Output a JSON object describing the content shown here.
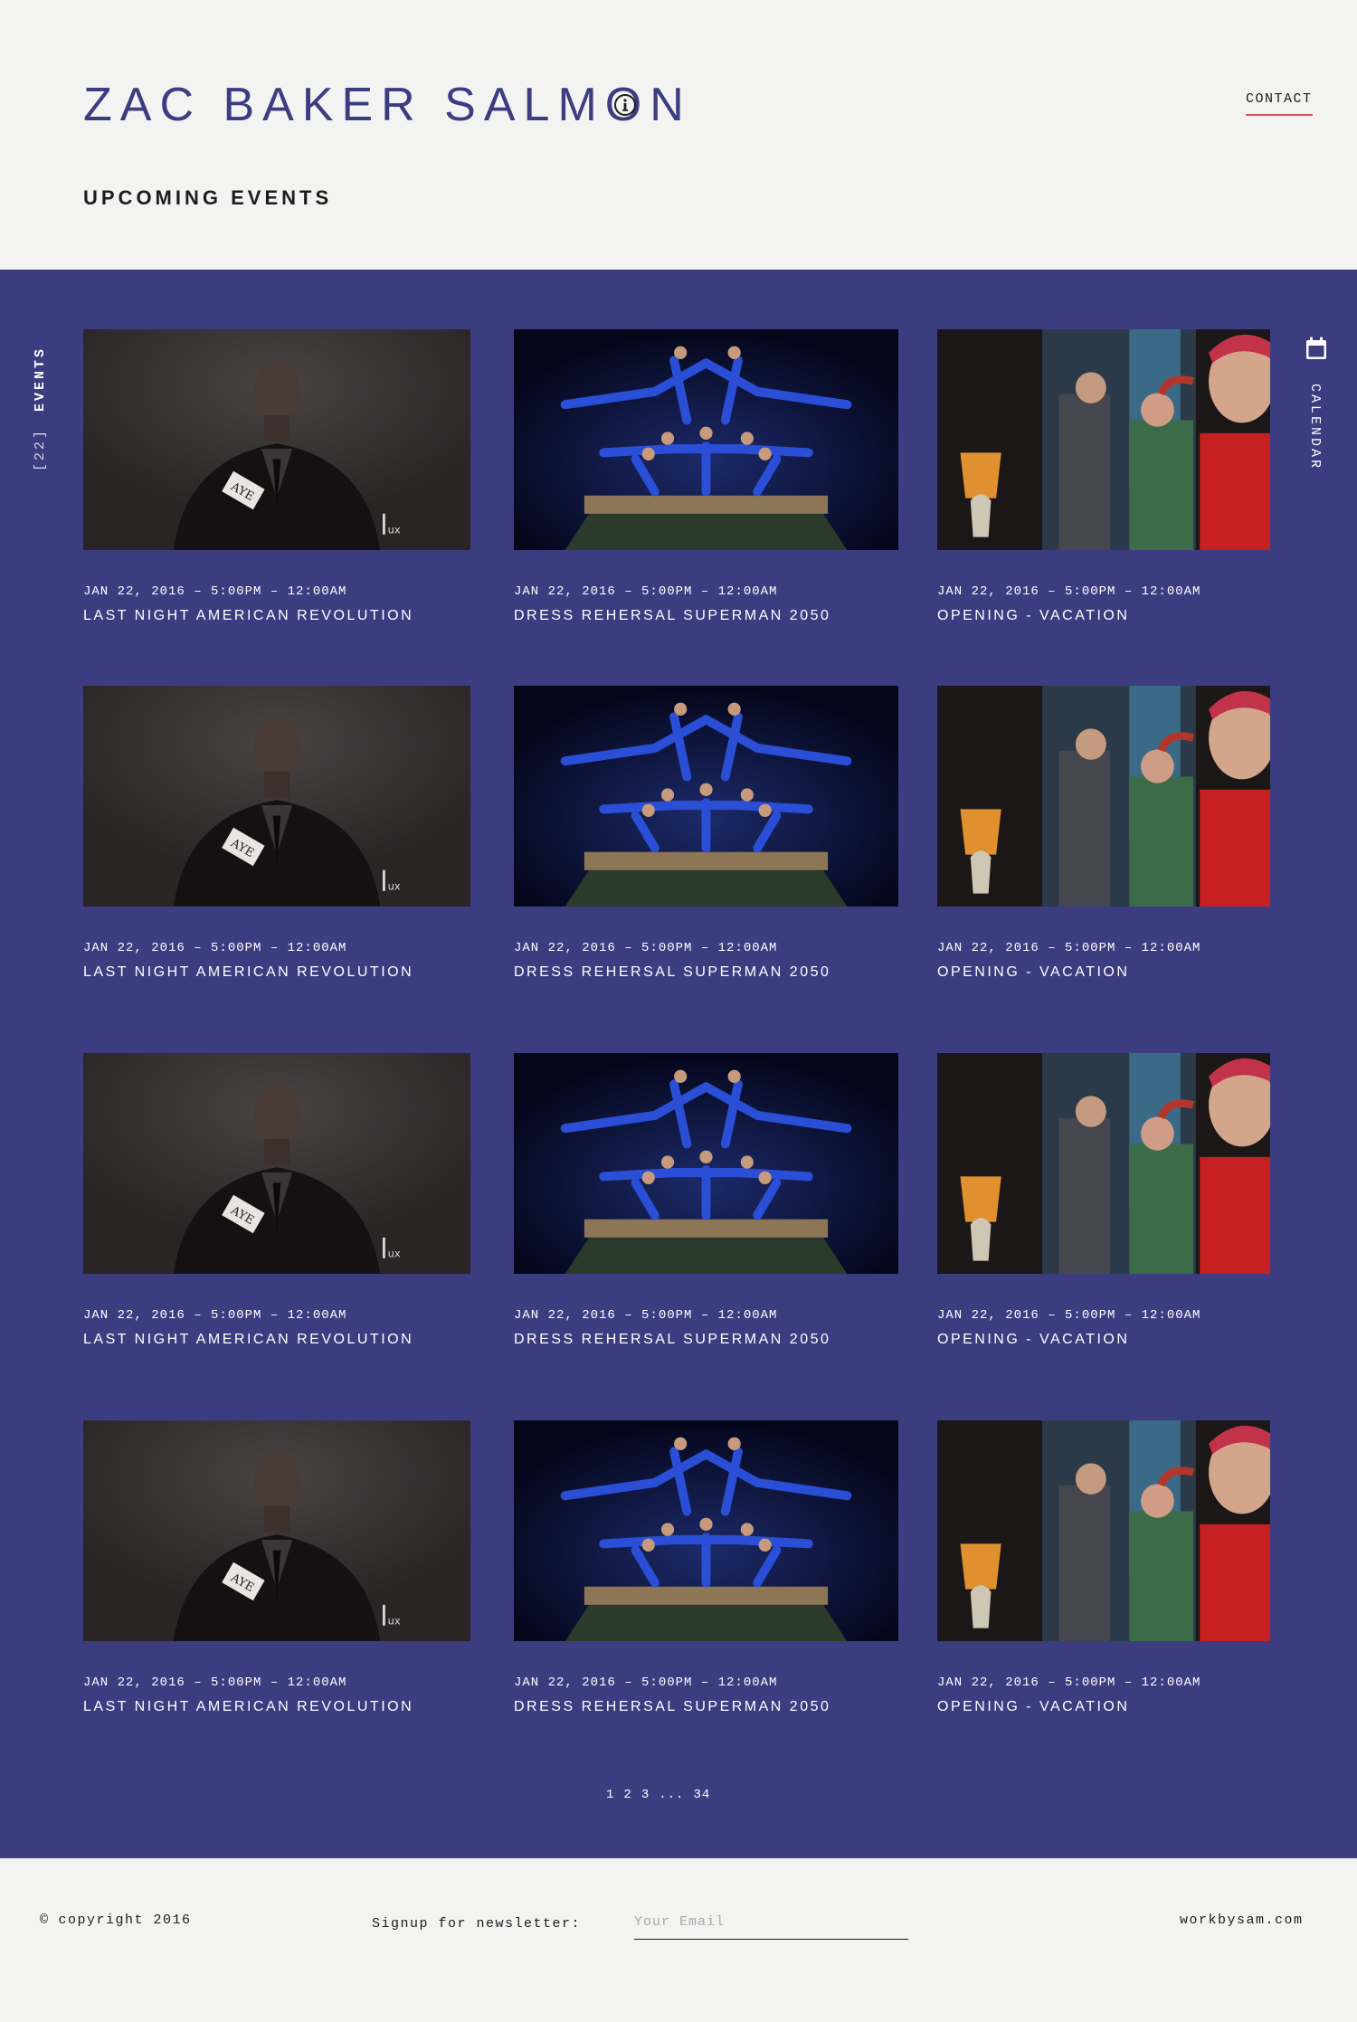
{
  "header": {
    "site_title": "ZAC BAKER SALMON",
    "contact_label": "CONTACT",
    "section_title": "UPCOMING EVENTS"
  },
  "sidebar_left": {
    "count": "[22]",
    "label": "EVENTS"
  },
  "sidebar_right": {
    "label": "CALENDAR",
    "icon": "calendar-icon"
  },
  "colors": {
    "band": "#3b3d80",
    "title": "#3b3d80",
    "accent_underline": "#d9534f",
    "page_bg": "#f3f3f2"
  },
  "events": [
    {
      "date": "JAN 22, 2016 – 5:00PM – 12:00AM",
      "title": "LAST NIGHT AMERICAN REVOLUTION",
      "image": "portrait"
    },
    {
      "date": "JAN 22, 2016 – 5:00PM – 12:00AM",
      "title": "DRESS REHERSAL SUPERMAN 2050",
      "image": "dancers"
    },
    {
      "date": "JAN 22, 2016 – 5:00PM – 12:00AM",
      "title": "OPENING - VACATION",
      "image": "scene"
    },
    {
      "date": "JAN 22, 2016 – 5:00PM – 12:00AM",
      "title": "LAST NIGHT AMERICAN REVOLUTION",
      "image": "portrait"
    },
    {
      "date": "JAN 22, 2016 – 5:00PM – 12:00AM",
      "title": "DRESS REHERSAL SUPERMAN 2050",
      "image": "dancers"
    },
    {
      "date": "JAN 22, 2016 – 5:00PM – 12:00AM",
      "title": "OPENING - VACATION",
      "image": "scene"
    },
    {
      "date": "JAN 22, 2016 – 5:00PM – 12:00AM",
      "title": "LAST NIGHT AMERICAN REVOLUTION",
      "image": "portrait"
    },
    {
      "date": "JAN 22, 2016 – 5:00PM – 12:00AM",
      "title": "DRESS REHERSAL SUPERMAN 2050",
      "image": "dancers"
    },
    {
      "date": "JAN 22, 2016 – 5:00PM – 12:00AM",
      "title": "OPENING - VACATION",
      "image": "scene"
    },
    {
      "date": "JAN 22, 2016 – 5:00PM – 12:00AM",
      "title": "LAST NIGHT AMERICAN REVOLUTION",
      "image": "portrait"
    },
    {
      "date": "JAN 22, 2016 – 5:00PM – 12:00AM",
      "title": "DRESS REHERSAL SUPERMAN 2050",
      "image": "dancers"
    },
    {
      "date": "JAN 22, 2016 – 5:00PM – 12:00AM",
      "title": "OPENING - VACATION",
      "image": "scene"
    }
  ],
  "image_text": {
    "card_text": "AYE",
    "logo_text": "ux"
  },
  "pagination": {
    "pages": [
      "1",
      "2",
      "3",
      "...",
      "34"
    ]
  },
  "footer": {
    "copyright_symbol": "©",
    "copyright_text": "copyright 2016",
    "newsletter_label": "Signup for newsletter:",
    "email_placeholder": "Your Email",
    "credit": "workbysam.com"
  }
}
